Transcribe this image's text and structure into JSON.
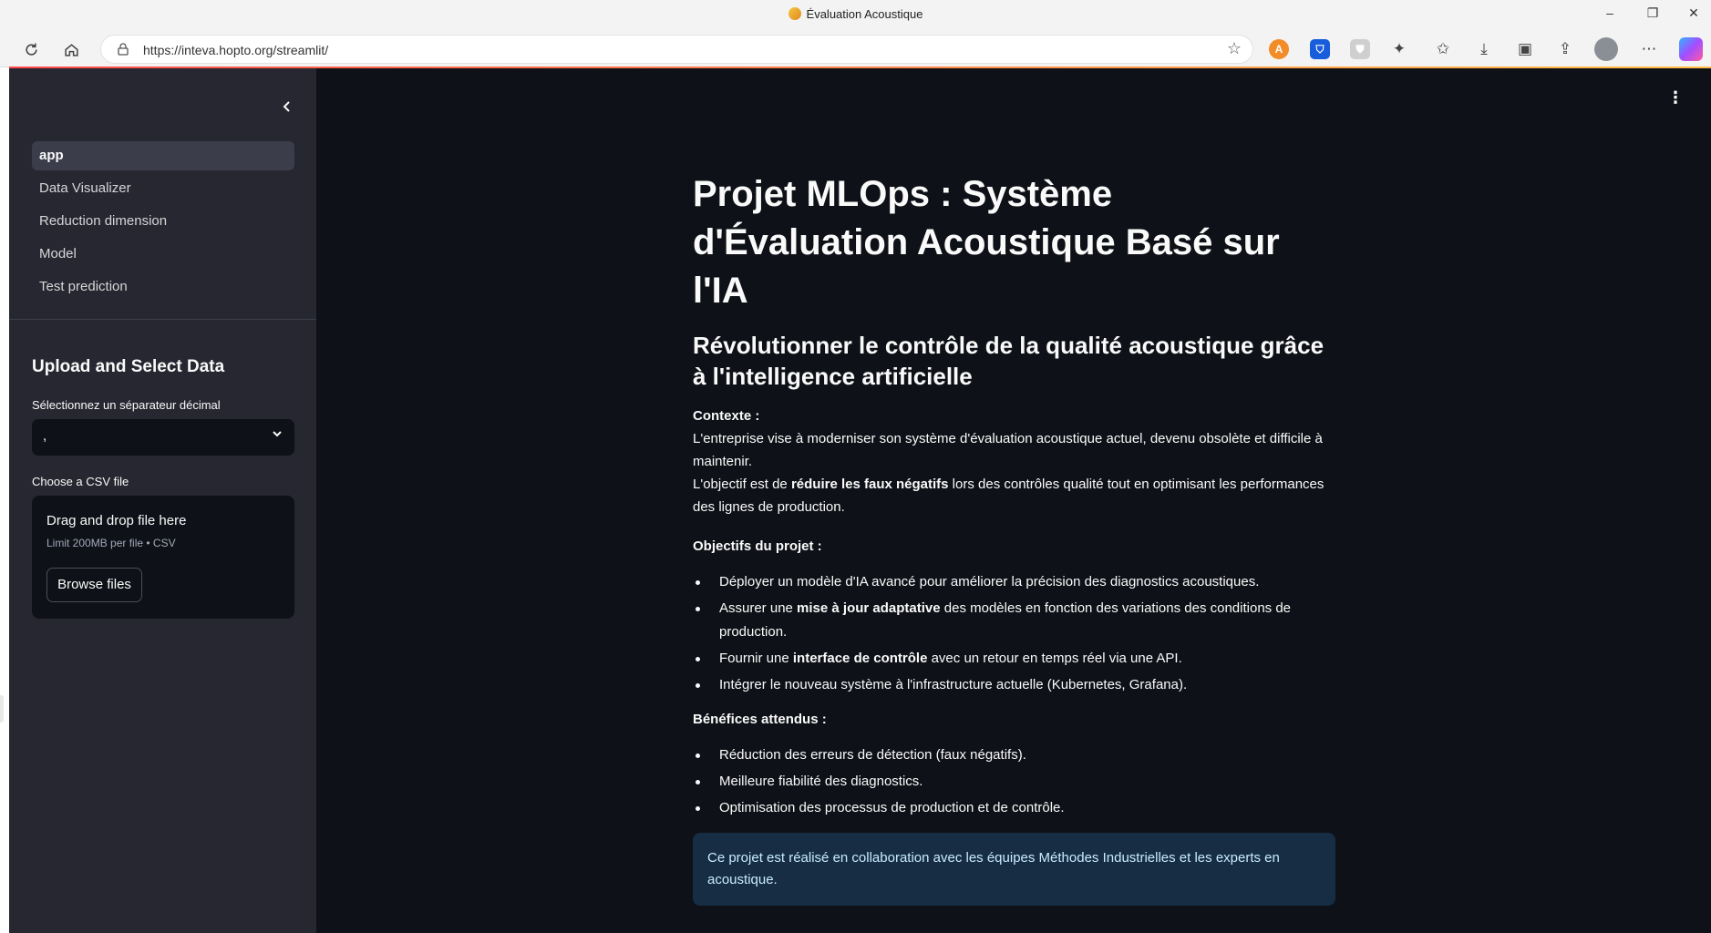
{
  "browser": {
    "tab_title": "Évaluation Acoustique",
    "url": "https://inteva.hopto.org/streamlit/",
    "controls": {
      "minimize": "–",
      "restore": "❐",
      "close": "✕"
    }
  },
  "sidebar": {
    "nav": [
      {
        "label": "app",
        "active": true
      },
      {
        "label": "Data Visualizer",
        "active": false
      },
      {
        "label": "Reduction dimension",
        "active": false
      },
      {
        "label": "Model",
        "active": false
      },
      {
        "label": "Test prediction",
        "active": false
      }
    ],
    "header": "Upload and Select Data",
    "separator_label": "Sélectionnez un séparateur décimal",
    "separator_value": ",",
    "csv_label": "Choose a CSV file",
    "uploader": {
      "drag_text": "Drag and drop file here",
      "limit_text": "Limit 200MB per file • CSV",
      "browse_label": "Browse files"
    }
  },
  "main": {
    "title": "Projet MLOps : Système d'Évaluation Acoustique Basé sur l'IA",
    "subtitle": "Révolutionner le contrôle de la qualité acoustique grâce à l'intelligence artificielle",
    "context_label": "Contexte :",
    "context_line1": "L'entreprise vise à moderniser son système d'évaluation acoustique actuel, devenu obsolète et difficile à maintenir.",
    "context_line2_a": "L'objectif est de ",
    "context_line2_b": "réduire les faux négatifs",
    "context_line2_c": " lors des contrôles qualité tout en optimisant les performances des lignes de production.",
    "objectives_label": "Objectifs du projet :",
    "obj1": "Déployer un modèle d'IA avancé pour améliorer la précision des diagnostics acoustiques.",
    "obj2_a": "Assurer une ",
    "obj2_b": "mise à jour adaptative",
    "obj2_c": " des modèles en fonction des variations des conditions de production.",
    "obj3_a": "Fournir une ",
    "obj3_b": "interface de contrôle",
    "obj3_c": " avec un retour en temps réel via une API.",
    "obj4": "Intégrer le nouveau système à l'infrastructure actuelle (Kubernetes, Grafana).",
    "benefits_label": "Bénéfices attendus :",
    "benefits": [
      "Réduction des erreurs de détection (faux négatifs).",
      "Meilleure fiabilité des diagnostics.",
      "Optimisation des processus de production et de contrôle."
    ],
    "info": "Ce projet est réalisé en collaboration avec les équipes Méthodes Industrielles et les experts en acoustique."
  },
  "colors": {
    "app_bg": "#0e1117",
    "sidebar_bg": "#262730",
    "info_bg": "#172d43",
    "info_text": "#c7ebff"
  }
}
